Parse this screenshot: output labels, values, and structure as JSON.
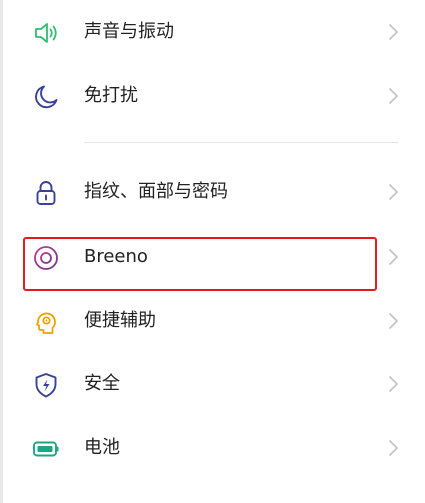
{
  "settings": {
    "items": [
      {
        "label": "声音与振动",
        "icon": "speaker-icon",
        "color": "#2fbf71"
      },
      {
        "label": "免打扰",
        "icon": "moon-icon",
        "color": "#3a4298"
      },
      {
        "label": "指纹、面部与密码",
        "icon": "lock-icon",
        "color": "#3a4298"
      },
      {
        "label": "Breeno",
        "icon": "breeno-icon",
        "color": "#9b3b7d"
      },
      {
        "label": "便捷辅助",
        "icon": "assist-icon",
        "color": "#f0a000"
      },
      {
        "label": "安全",
        "icon": "shield-icon",
        "color": "#3a4298"
      },
      {
        "label": "电池",
        "icon": "battery-icon",
        "color": "#1aa784"
      }
    ]
  },
  "highlight": {
    "target": "Breeno",
    "color": "#e21b1b"
  }
}
